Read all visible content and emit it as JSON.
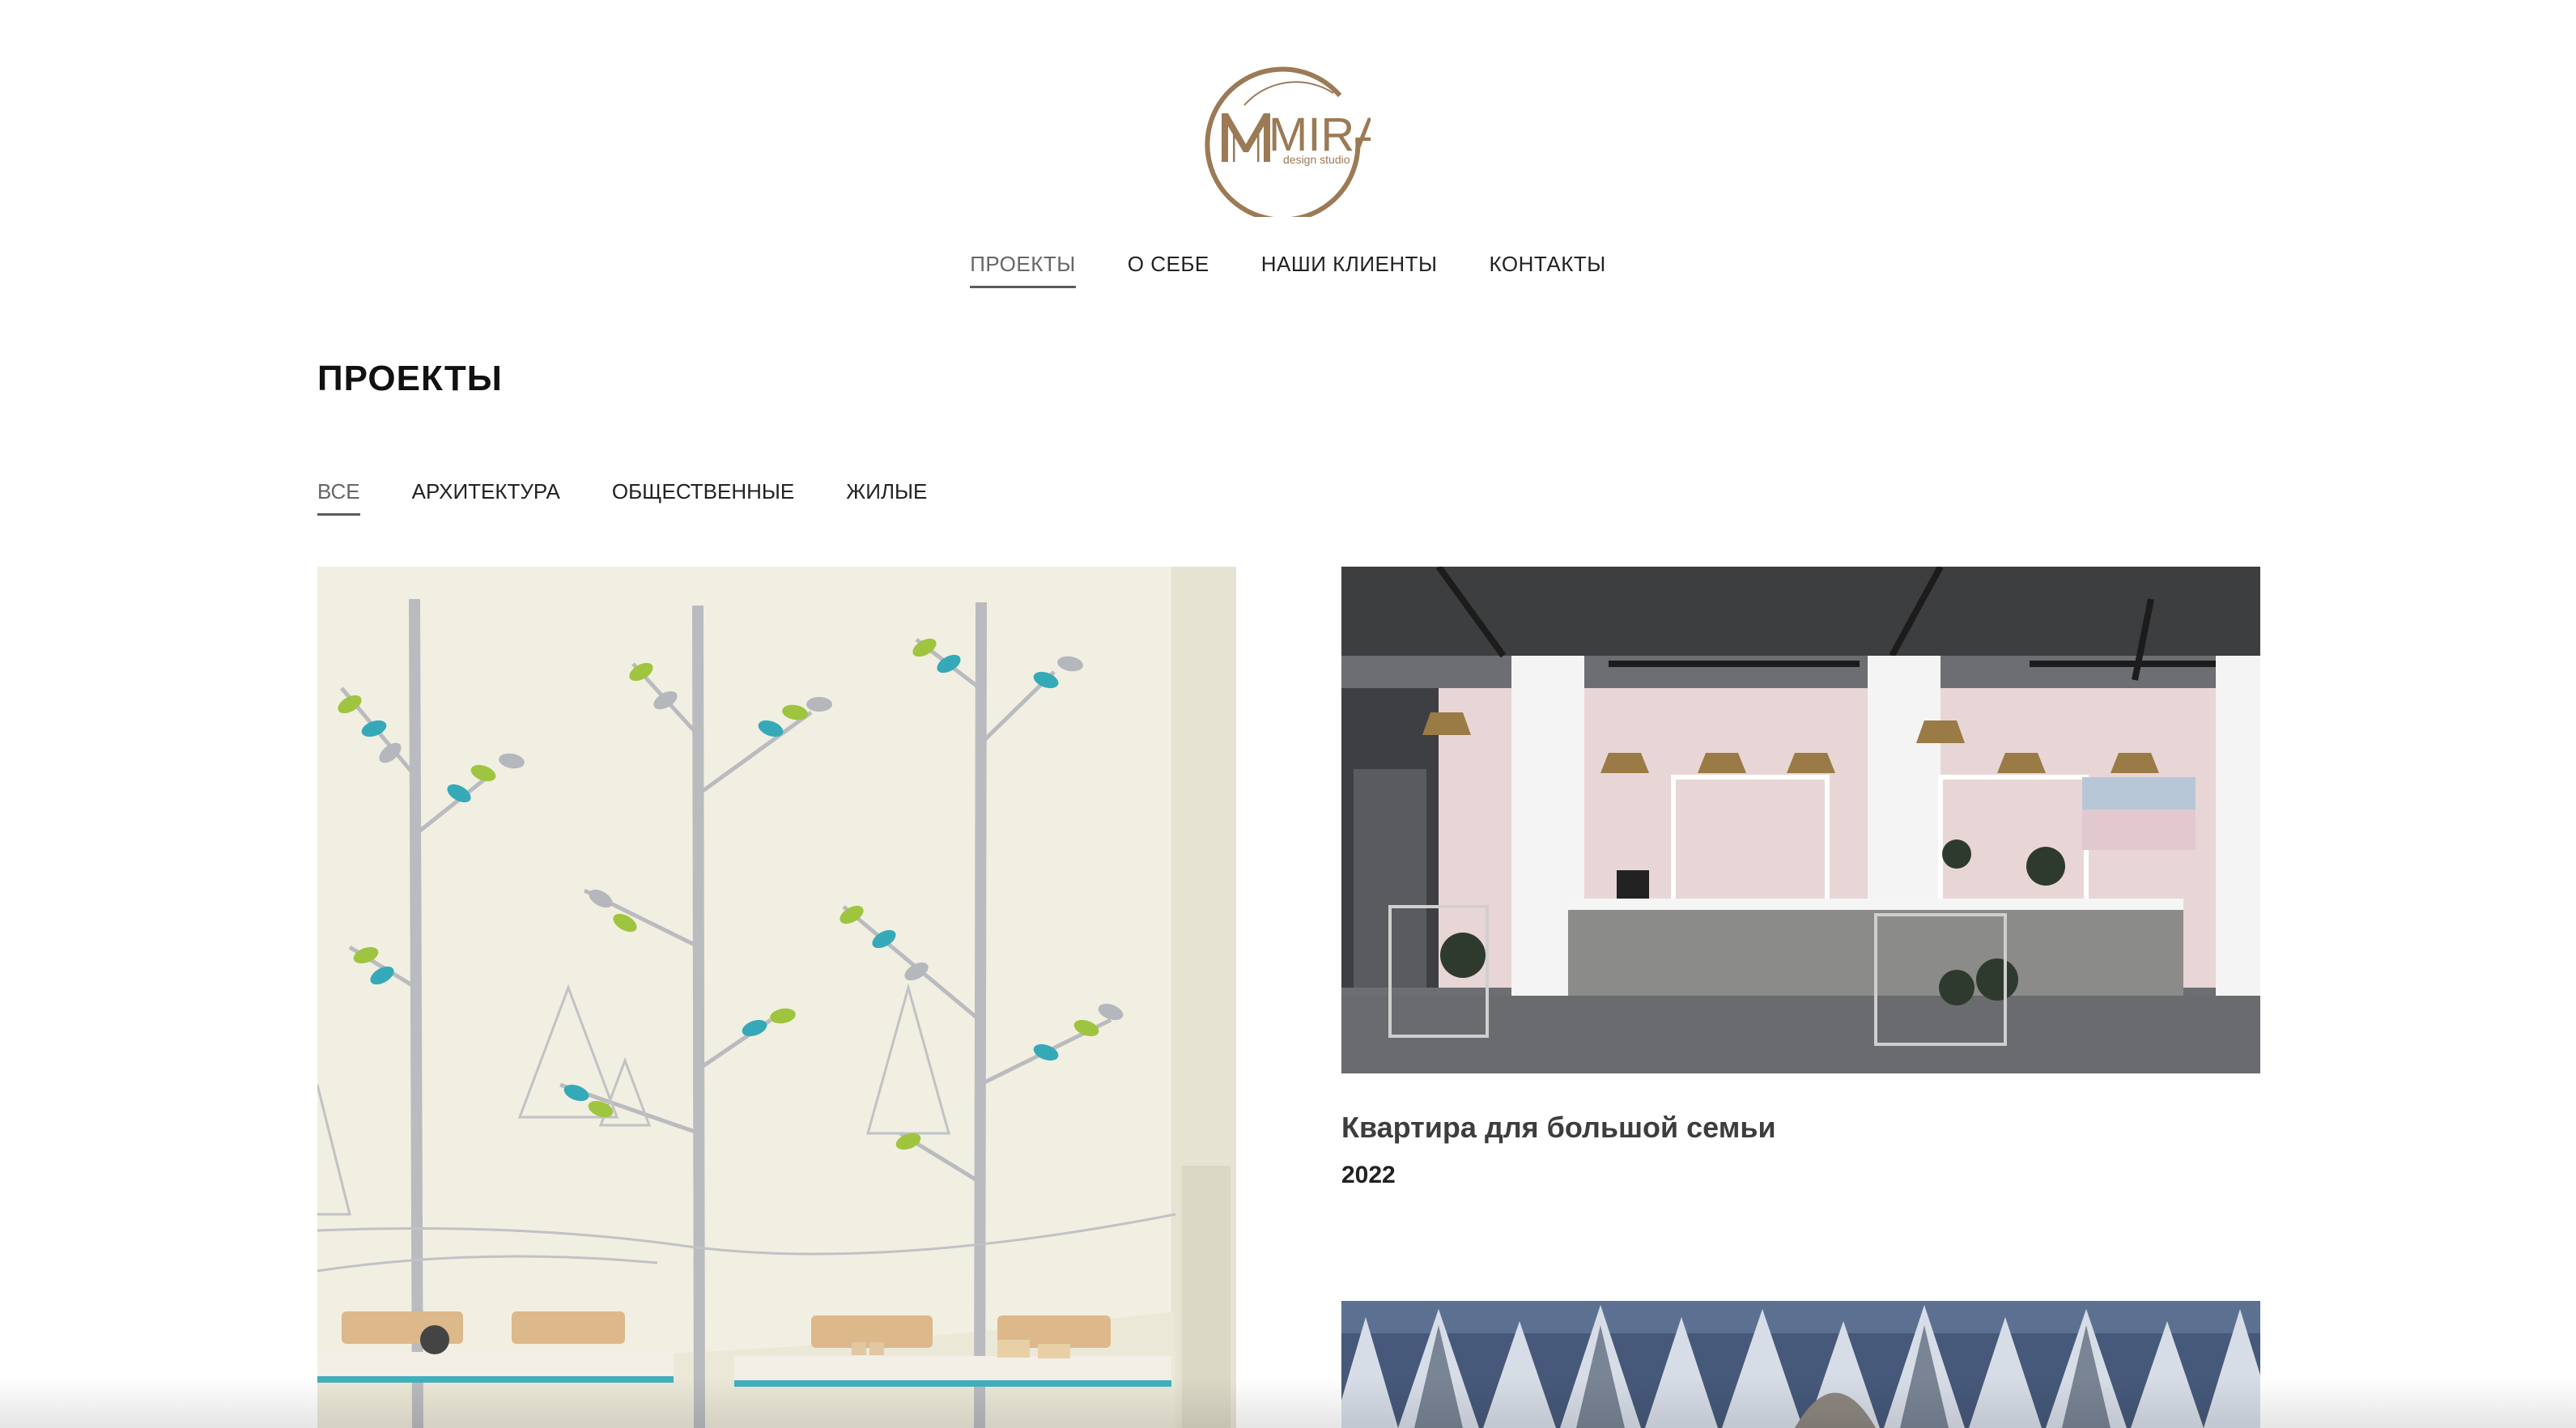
{
  "logo": {
    "text": "MIRA",
    "subtext": "design studio",
    "color": "#9b7a55"
  },
  "nav": {
    "items": [
      {
        "label": "ПРОЕКТЫ"
      },
      {
        "label": "О СЕБЕ"
      },
      {
        "label": "НАШИ КЛИЕНТЫ"
      },
      {
        "label": "КОНТАКТЫ"
      }
    ],
    "active": "ПРОЕКТЫ"
  },
  "section": {
    "title": "ПРОЕКТЫ"
  },
  "filters": {
    "items": [
      {
        "label": "ВСЕ"
      },
      {
        "label": "АРХИТЕКТУРА"
      },
      {
        "label": "ОБЩЕСТВЕННЫЕ"
      },
      {
        "label": "ЖИЛЫЕ"
      }
    ],
    "active": "ВСЕ"
  },
  "projects": [
    {
      "title": "",
      "year": "",
      "image": "kindergarten-mural-image"
    },
    {
      "title": "Квартира для большой семьи",
      "year": "2022",
      "image": "cafe-interior-image"
    },
    {
      "title": "",
      "year": "",
      "image": "snowy-forest-dome-image"
    }
  ]
}
